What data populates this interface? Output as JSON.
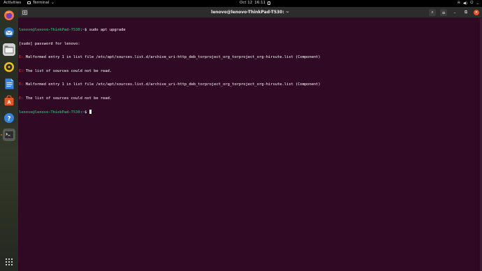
{
  "topbar": {
    "activities": "Activities",
    "app_name": "Terminal",
    "date": "Oct 12",
    "time": "16:11",
    "tray_icons": [
      "network-icon",
      "volume-icon",
      "power-icon",
      "chevron-down-icon"
    ]
  },
  "dock": {
    "apps": [
      "firefox",
      "thunderbird",
      "files",
      "rhythmbox",
      "libreoffice-writer",
      "ubuntu-software",
      "help",
      "terminal"
    ],
    "show_apps_label": "Show Applications",
    "accent_color": "#e95420"
  },
  "window": {
    "title": "lenovo@lenovo-ThinkPad-T530: ~",
    "background": "#300a24"
  },
  "terminal": {
    "prompt_user": "lenovo@lenovo-ThinkPad-T530",
    "prompt_path": "~",
    "command": "sudo apt upgrade",
    "sudo_prompt": "[sudo] password for lenovo:",
    "error_tag_e": "E:",
    "err1": "Malformed entry 1 in list file /etc/apt/sources.list.d/archive_uri-http_deb_torproject_org_torproject_org-hirsute.list (Component)",
    "err2": "The list of sources could not be read."
  }
}
